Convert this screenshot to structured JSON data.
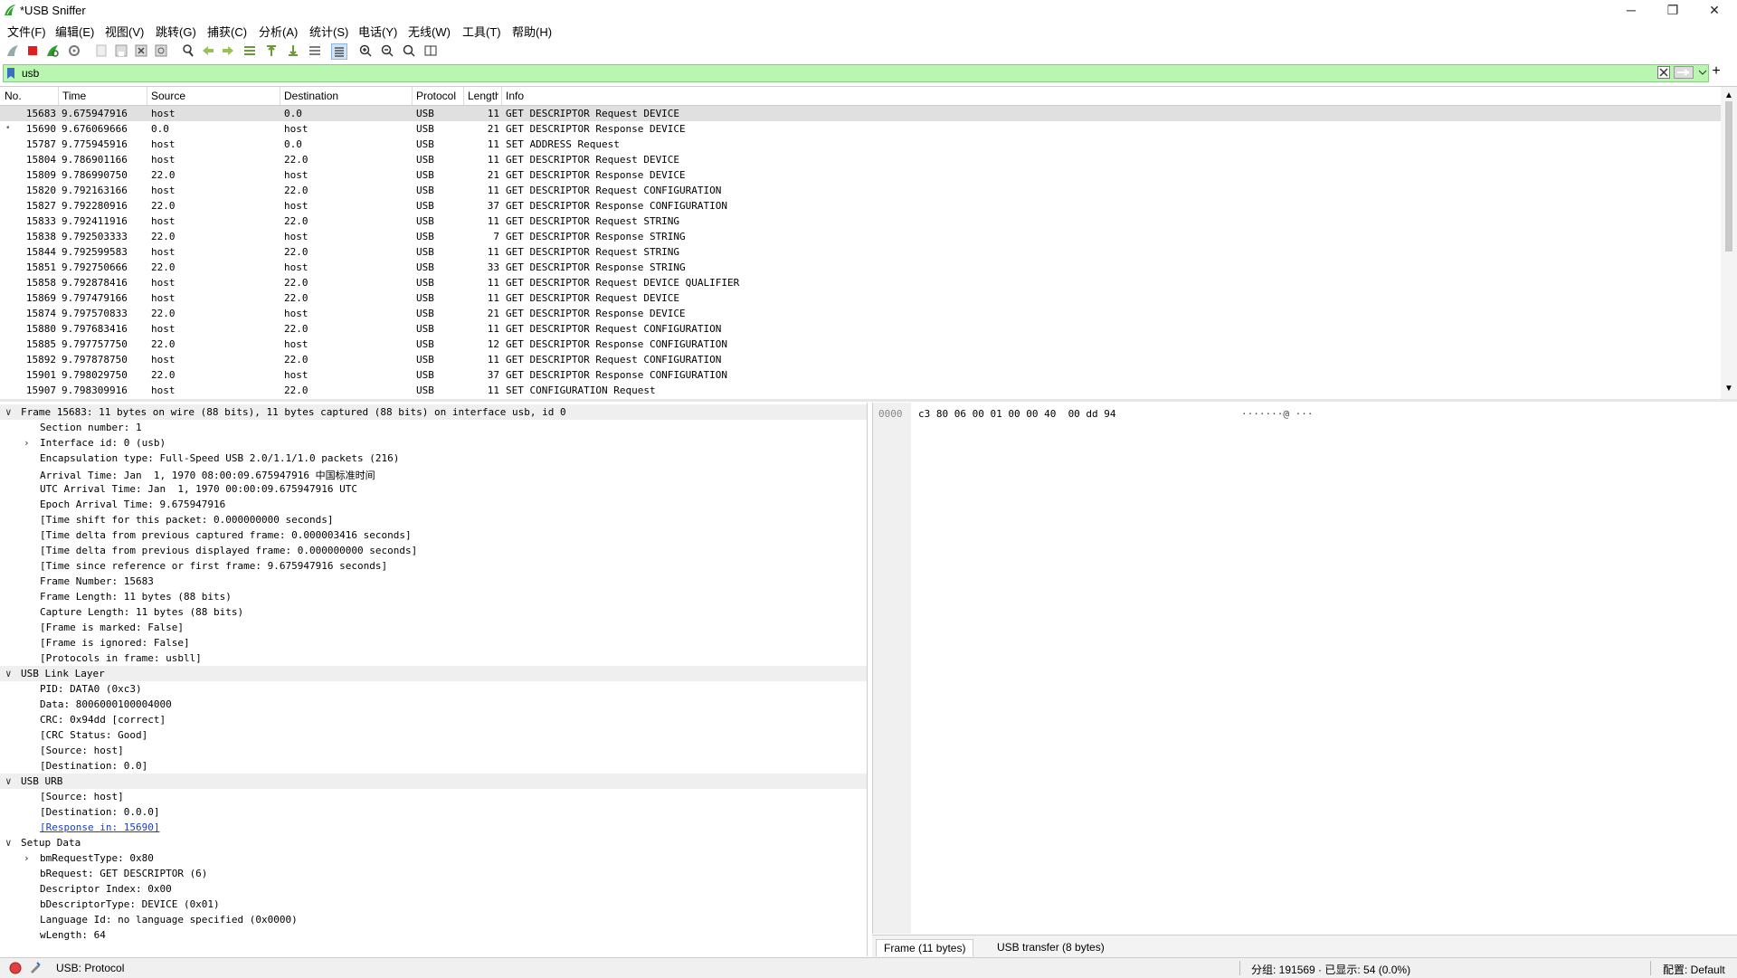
{
  "window": {
    "title": "*USB Sniffer",
    "minimize": "─",
    "restore": "❐",
    "close": "✕"
  },
  "menu": [
    "文件(F)",
    "编辑(E)",
    "视图(V)",
    "跳转(G)",
    "捕获(C)",
    "分析(A)",
    "统计(S)",
    "电话(Y)",
    "无线(W)",
    "工具(T)",
    "帮助(H)"
  ],
  "toolbar_icons": [
    "shark-fin-start-icon",
    "stop-capture-icon",
    "restart-capture-icon",
    "capture-options-icon",
    "open-file-icon",
    "save-file-icon",
    "close-file-icon",
    "reload-file-icon",
    "find-packet-icon",
    "go-back-icon",
    "go-forward-icon",
    "go-to-packet-icon",
    "go-first-icon",
    "go-last-icon",
    "auto-scroll-icon",
    "colorize-icon",
    "zoom-in-icon",
    "zoom-out-icon",
    "zoom-normal-icon",
    "resize-columns-icon"
  ],
  "filter": {
    "value": "usb",
    "add_label": "+"
  },
  "colors": {
    "filter_bg": "#b9f6b0",
    "selected_row": "#e0e0e0",
    "link": "#1a3fc0",
    "accent_green": "#2fa02f",
    "stop_red": "#e02020"
  },
  "packet_list": {
    "columns": [
      "No.",
      "Time",
      "Source",
      "Destination",
      "Protocol",
      "Length",
      "Info"
    ],
    "rows": [
      {
        "no": "15683",
        "time": "9.675947916",
        "src": "host",
        "dst": "0.0",
        "proto": "USB",
        "len": "11",
        "info": "GET DESCRIPTOR Request DEVICE",
        "selected": true
      },
      {
        "no": "15690",
        "time": "9.676069666",
        "src": "0.0",
        "dst": "host",
        "proto": "USB",
        "len": "21",
        "info": "GET DESCRIPTOR Response DEVICE",
        "marker": "•"
      },
      {
        "no": "15787",
        "time": "9.775945916",
        "src": "host",
        "dst": "0.0",
        "proto": "USB",
        "len": "11",
        "info": "SET ADDRESS Request"
      },
      {
        "no": "15804",
        "time": "9.786901166",
        "src": "host",
        "dst": "22.0",
        "proto": "USB",
        "len": "11",
        "info": "GET DESCRIPTOR Request DEVICE"
      },
      {
        "no": "15809",
        "time": "9.786990750",
        "src": "22.0",
        "dst": "host",
        "proto": "USB",
        "len": "21",
        "info": "GET DESCRIPTOR Response DEVICE"
      },
      {
        "no": "15820",
        "time": "9.792163166",
        "src": "host",
        "dst": "22.0",
        "proto": "USB",
        "len": "11",
        "info": "GET DESCRIPTOR Request CONFIGURATION"
      },
      {
        "no": "15827",
        "time": "9.792280916",
        "src": "22.0",
        "dst": "host",
        "proto": "USB",
        "len": "37",
        "info": "GET DESCRIPTOR Response CONFIGURATION"
      },
      {
        "no": "15833",
        "time": "9.792411916",
        "src": "host",
        "dst": "22.0",
        "proto": "USB",
        "len": "11",
        "info": "GET DESCRIPTOR Request STRING"
      },
      {
        "no": "15838",
        "time": "9.792503333",
        "src": "22.0",
        "dst": "host",
        "proto": "USB",
        "len": "7",
        "info": "GET DESCRIPTOR Response STRING"
      },
      {
        "no": "15844",
        "time": "9.792599583",
        "src": "host",
        "dst": "22.0",
        "proto": "USB",
        "len": "11",
        "info": "GET DESCRIPTOR Request STRING"
      },
      {
        "no": "15851",
        "time": "9.792750666",
        "src": "22.0",
        "dst": "host",
        "proto": "USB",
        "len": "33",
        "info": "GET DESCRIPTOR Response STRING"
      },
      {
        "no": "15858",
        "time": "9.792878416",
        "src": "host",
        "dst": "22.0",
        "proto": "USB",
        "len": "11",
        "info": "GET DESCRIPTOR Request DEVICE QUALIFIER"
      },
      {
        "no": "15869",
        "time": "9.797479166",
        "src": "host",
        "dst": "22.0",
        "proto": "USB",
        "len": "11",
        "info": "GET DESCRIPTOR Request DEVICE"
      },
      {
        "no": "15874",
        "time": "9.797570833",
        "src": "22.0",
        "dst": "host",
        "proto": "USB",
        "len": "21",
        "info": "GET DESCRIPTOR Response DEVICE"
      },
      {
        "no": "15880",
        "time": "9.797683416",
        "src": "host",
        "dst": "22.0",
        "proto": "USB",
        "len": "11",
        "info": "GET DESCRIPTOR Request CONFIGURATION"
      },
      {
        "no": "15885",
        "time": "9.797757750",
        "src": "22.0",
        "dst": "host",
        "proto": "USB",
        "len": "12",
        "info": "GET DESCRIPTOR Response CONFIGURATION"
      },
      {
        "no": "15892",
        "time": "9.797878750",
        "src": "host",
        "dst": "22.0",
        "proto": "USB",
        "len": "11",
        "info": "GET DESCRIPTOR Request CONFIGURATION"
      },
      {
        "no": "15901",
        "time": "9.798029750",
        "src": "22.0",
        "dst": "host",
        "proto": "USB",
        "len": "37",
        "info": "GET DESCRIPTOR Response CONFIGURATION"
      },
      {
        "no": "15907",
        "time": "9.798309916",
        "src": "host",
        "dst": "22.0",
        "proto": "USB",
        "len": "11",
        "info": "SET CONFIGURATION Request"
      }
    ]
  },
  "details": [
    {
      "level": 0,
      "expander": "∨",
      "section": true,
      "text": "Frame 15683: 11 bytes on wire (88 bits), 11 bytes captured (88 bits) on interface usb, id 0"
    },
    {
      "level": 1,
      "text": "Section number: 1"
    },
    {
      "level": 1,
      "expander": "›",
      "text": "Interface id: 0 (usb)"
    },
    {
      "level": 1,
      "text": "Encapsulation type: Full-Speed USB 2.0/1.1/1.0 packets (216)"
    },
    {
      "level": 1,
      "text": "Arrival Time: Jan  1, 1970 08:00:09.675947916 中国标准时间"
    },
    {
      "level": 1,
      "text": "UTC Arrival Time: Jan  1, 1970 00:00:09.675947916 UTC"
    },
    {
      "level": 1,
      "text": "Epoch Arrival Time: 9.675947916"
    },
    {
      "level": 1,
      "text": "[Time shift for this packet: 0.000000000 seconds]"
    },
    {
      "level": 1,
      "text": "[Time delta from previous captured frame: 0.000003416 seconds]"
    },
    {
      "level": 1,
      "text": "[Time delta from previous displayed frame: 0.000000000 seconds]"
    },
    {
      "level": 1,
      "text": "[Time since reference or first frame: 9.675947916 seconds]"
    },
    {
      "level": 1,
      "text": "Frame Number: 15683"
    },
    {
      "level": 1,
      "text": "Frame Length: 11 bytes (88 bits)"
    },
    {
      "level": 1,
      "text": "Capture Length: 11 bytes (88 bits)"
    },
    {
      "level": 1,
      "text": "[Frame is marked: False]"
    },
    {
      "level": 1,
      "text": "[Frame is ignored: False]"
    },
    {
      "level": 1,
      "text": "[Protocols in frame: usbll]"
    },
    {
      "level": 0,
      "expander": "∨",
      "section": true,
      "text": "USB Link Layer"
    },
    {
      "level": 1,
      "text": "PID: DATA0 (0xc3)"
    },
    {
      "level": 1,
      "text": "Data: 8006000100004000"
    },
    {
      "level": 1,
      "text": "CRC: 0x94dd [correct]"
    },
    {
      "level": 1,
      "text": "[CRC Status: Good]"
    },
    {
      "level": 1,
      "text": "[Source: host]"
    },
    {
      "level": 1,
      "text": "[Destination: 0.0]"
    },
    {
      "level": 0,
      "expander": "∨",
      "section": true,
      "text": "USB URB"
    },
    {
      "level": 1,
      "text": "[Source: host]"
    },
    {
      "level": 1,
      "text": "[Destination: 0.0.0]"
    },
    {
      "level": 1,
      "link": true,
      "text": "[Response in: 15690]"
    },
    {
      "level": 0,
      "expander": "∨",
      "text": "Setup Data"
    },
    {
      "level": 1,
      "expander": "›",
      "text": "bmRequestType: 0x80"
    },
    {
      "level": 1,
      "text": "bRequest: GET DESCRIPTOR (6)"
    },
    {
      "level": 1,
      "text": "Descriptor Index: 0x00"
    },
    {
      "level": 1,
      "text": "bDescriptorType: DEVICE (0x01)"
    },
    {
      "level": 1,
      "text": "Language Id: no language specified (0x0000)"
    },
    {
      "level": 1,
      "text": "wLength: 64"
    }
  ],
  "bytes": {
    "offset": "0000",
    "hex": "c3 80 06 00 01 00 00 40  00 dd 94",
    "ascii": "·······@ ···"
  },
  "bytes_tabs": [
    "Frame (11 bytes)",
    "USB transfer (8 bytes)"
  ],
  "status": {
    "protocol": "USB: Protocol",
    "packets": "分组: 191569 · 已显示: 54 (0.0%)",
    "profile": "配置: Default"
  }
}
